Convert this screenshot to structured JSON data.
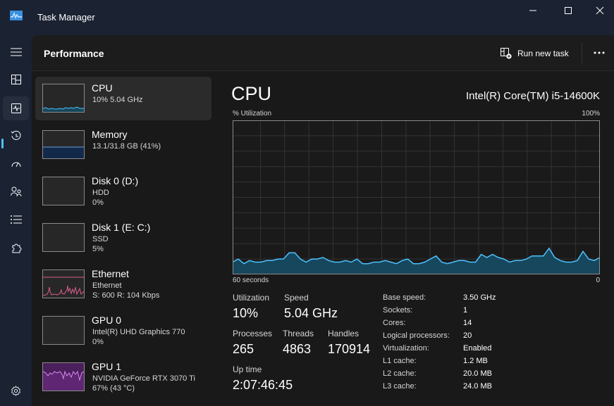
{
  "window": {
    "title": "Task Manager",
    "controls": {
      "minimize": "minimize-icon",
      "maximize": "maximize-icon",
      "close": "close-icon"
    }
  },
  "nav": {
    "items": [
      {
        "name": "menu",
        "icon": "hamburger-icon"
      },
      {
        "name": "processes",
        "icon": "grid-icon"
      },
      {
        "name": "performance",
        "icon": "performance-icon",
        "active": true
      },
      {
        "name": "app-history",
        "icon": "history-icon"
      },
      {
        "name": "startup-apps",
        "icon": "speedometer-icon"
      },
      {
        "name": "users",
        "icon": "users-icon"
      },
      {
        "name": "details",
        "icon": "list-icon"
      },
      {
        "name": "services",
        "icon": "puzzle-icon"
      },
      {
        "name": "settings",
        "icon": "gear-icon"
      }
    ]
  },
  "header": {
    "title": "Performance",
    "run_new_task": "Run new task",
    "more": "more-icon"
  },
  "perf_list": [
    {
      "title": "CPU",
      "line1": "10%  5.04 GHz",
      "line2": "",
      "selected": true,
      "color": "#4cc2ff"
    },
    {
      "title": "Memory",
      "line1": "13.1/31.8 GB (41%)",
      "line2": "",
      "color": "#4a86d8",
      "fraction": 0.41
    },
    {
      "title": "Disk 0 (D:)",
      "line1": "HDD",
      "line2": "0%",
      "color": "#6fbf4a"
    },
    {
      "title": "Disk 1 (E: C:)",
      "line1": "SSD",
      "line2": "5%",
      "color": "#6fbf4a"
    },
    {
      "title": "Ethernet",
      "line1": "Ethernet",
      "line2": "S: 600  R: 104 Kbps",
      "color": "#d95c8c"
    },
    {
      "title": "GPU 0",
      "line1": "Intel(R) UHD Graphics 770",
      "line2": "0%",
      "color": "#a24bd1"
    },
    {
      "title": "GPU 1",
      "line1": "NVIDIA GeForce RTX 3070 Ti",
      "line2": "67%  (43 °C)",
      "color": "#c458e8"
    }
  ],
  "detail": {
    "title": "CPU",
    "model": "Intel(R) Core(TM) i5-14600K",
    "y_label": "% Utilization",
    "y_max_label": "100%",
    "x_left_label": "60 seconds",
    "x_right_label": "0",
    "stats": {
      "utilization_label": "Utilization",
      "utilization": "10%",
      "speed_label": "Speed",
      "speed": "5.04 GHz",
      "processes_label": "Processes",
      "processes": "265",
      "threads_label": "Threads",
      "threads": "4863",
      "handles_label": "Handles",
      "handles": "170914",
      "uptime_label": "Up time",
      "uptime": "2:07:46:45"
    },
    "specs": [
      {
        "k": "Base speed:",
        "v": "3.50 GHz"
      },
      {
        "k": "Sockets:",
        "v": "1"
      },
      {
        "k": "Cores:",
        "v": "14"
      },
      {
        "k": "Logical processors:",
        "v": "20"
      },
      {
        "k": "Virtualization:",
        "v": "Enabled"
      },
      {
        "k": "L1 cache:",
        "v": "1.2 MB"
      },
      {
        "k": "L2 cache:",
        "v": "20.0 MB"
      },
      {
        "k": "L3 cache:",
        "v": "24.0 MB"
      }
    ]
  },
  "chart_data": {
    "type": "area",
    "title": "CPU % Utilization",
    "xlabel": "60 seconds",
    "ylabel": "% Utilization",
    "ylim": [
      0,
      100
    ],
    "xlim": [
      60,
      0
    ],
    "grid": true,
    "line_color": "#4cc2ff",
    "fill_color": "#17475c",
    "values": [
      8,
      10,
      7,
      9,
      8,
      8,
      9,
      9,
      10,
      10,
      14,
      14,
      10,
      8,
      10,
      10,
      11,
      9,
      8,
      8,
      9,
      8,
      10,
      7,
      7,
      8,
      8,
      9,
      8,
      7,
      9,
      10,
      7,
      7,
      8,
      10,
      12,
      8,
      7,
      8,
      9,
      9,
      8,
      8,
      13,
      11,
      13,
      11,
      10,
      8,
      9,
      9,
      10,
      12,
      12,
      12,
      17,
      11,
      9,
      8,
      8,
      9,
      15,
      10,
      9,
      11
    ]
  }
}
